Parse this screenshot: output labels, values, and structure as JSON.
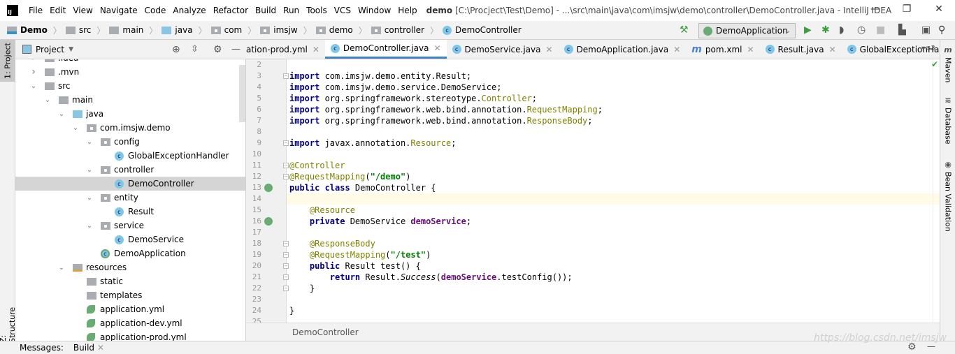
{
  "titlebar": {
    "menu": [
      "File",
      "Edit",
      "View",
      "Navigate",
      "Code",
      "Analyze",
      "Refactor",
      "Build",
      "Run",
      "Tools",
      "VCS",
      "Window",
      "Help"
    ],
    "project": "demo",
    "path": "[C:\\Procject\\Test\\Demo] - ...\\src\\main\\java\\com\\imsjw\\demo\\controller\\DemoController.java - IntelliJ IDEA",
    "logo": "IJ"
  },
  "navbar": {
    "crumbs": [
      {
        "label": "Demo",
        "icon": "module"
      },
      {
        "label": "src",
        "icon": "folder"
      },
      {
        "label": "main",
        "icon": "folder"
      },
      {
        "label": "java",
        "icon": "source-folder"
      },
      {
        "label": "com",
        "icon": "package"
      },
      {
        "label": "imsjw",
        "icon": "package"
      },
      {
        "label": "demo",
        "icon": "package"
      },
      {
        "label": "controller",
        "icon": "package"
      },
      {
        "label": "DemoController",
        "icon": "class"
      }
    ],
    "run_config": "DemoApplication"
  },
  "left_strip": {
    "project_tab": "1: Project",
    "structure_tab": "Z: Structure"
  },
  "project_panel": {
    "title": "Project",
    "tree": [
      {
        "label": ".idea",
        "level": 1,
        "type": "folder",
        "arrow": "right"
      },
      {
        "label": ".mvn",
        "level": 1,
        "type": "folder",
        "arrow": "right"
      },
      {
        "label": "src",
        "level": 1,
        "type": "folder",
        "arrow": "down"
      },
      {
        "label": "main",
        "level": 2,
        "type": "folder",
        "arrow": "down"
      },
      {
        "label": "java",
        "level": 3,
        "type": "source",
        "arrow": "down"
      },
      {
        "label": "com.imsjw.demo",
        "level": 4,
        "type": "package",
        "arrow": "down"
      },
      {
        "label": "config",
        "level": 5,
        "type": "package",
        "arrow": "down"
      },
      {
        "label": "GlobalExceptionHandler",
        "level": 6,
        "type": "class"
      },
      {
        "label": "controller",
        "level": 5,
        "type": "package",
        "arrow": "down"
      },
      {
        "label": "DemoController",
        "level": 6,
        "type": "class",
        "selected": true
      },
      {
        "label": "entity",
        "level": 5,
        "type": "package",
        "arrow": "down"
      },
      {
        "label": "Result",
        "level": 6,
        "type": "class"
      },
      {
        "label": "service",
        "level": 5,
        "type": "package",
        "arrow": "down"
      },
      {
        "label": "DemoService",
        "level": 6,
        "type": "class"
      },
      {
        "label": "DemoApplication",
        "level": 5,
        "type": "spring-class"
      },
      {
        "label": "resources",
        "level": 3,
        "type": "resources",
        "arrow": "down"
      },
      {
        "label": "static",
        "level": 4,
        "type": "folder"
      },
      {
        "label": "templates",
        "level": 4,
        "type": "folder"
      },
      {
        "label": "application.yml",
        "level": 4,
        "type": "yml"
      },
      {
        "label": "application-dev.yml",
        "level": 4,
        "type": "yml"
      },
      {
        "label": "application-prod.yml",
        "level": 4,
        "type": "yml"
      }
    ]
  },
  "tabs": [
    {
      "label": "ation-prod.yml",
      "icon": "none"
    },
    {
      "label": "DemoController.java",
      "icon": "class",
      "active": true
    },
    {
      "label": "DemoService.java",
      "icon": "class"
    },
    {
      "label": "DemoApplication.java",
      "icon": "spring-class"
    },
    {
      "label": "pom.xml",
      "icon": "maven"
    },
    {
      "label": "Result.java",
      "icon": "class"
    },
    {
      "label": "GlobalExceptionHandler.java",
      "icon": "class"
    }
  ],
  "tabs_overflow": "3",
  "editor": {
    "current_line": 14,
    "lines": [
      {
        "n": 2,
        "t": []
      },
      {
        "n": 3,
        "fold": true,
        "t": [
          [
            "import",
            "kw"
          ],
          [
            " com.imsjw.demo.entity.Result;",
            ""
          ]
        ]
      },
      {
        "n": 4,
        "t": [
          [
            "import",
            "kw"
          ],
          [
            " com.imsjw.demo.service.DemoService;",
            ""
          ]
        ]
      },
      {
        "n": 5,
        "t": [
          [
            "import",
            "kw"
          ],
          [
            " org.springframework.stereotype.",
            ""
          ],
          [
            "Controller",
            "an"
          ],
          [
            ";",
            ""
          ]
        ]
      },
      {
        "n": 6,
        "t": [
          [
            "import",
            "kw"
          ],
          [
            " org.springframework.web.bind.annotation.",
            ""
          ],
          [
            "RequestMapping",
            "an"
          ],
          [
            ";",
            ""
          ]
        ]
      },
      {
        "n": 7,
        "t": [
          [
            "import",
            "kw"
          ],
          [
            " org.springframework.web.bind.annotation.",
            ""
          ],
          [
            "ResponseBody",
            "an"
          ],
          [
            ";",
            ""
          ]
        ]
      },
      {
        "n": 8,
        "t": []
      },
      {
        "n": 9,
        "fold": true,
        "t": [
          [
            "import",
            "kw"
          ],
          [
            " javax.annotation.",
            ""
          ],
          [
            "Resource",
            "an"
          ],
          [
            ";",
            ""
          ]
        ]
      },
      {
        "n": 10,
        "t": []
      },
      {
        "n": 11,
        "fold": true,
        "t": [
          [
            "@Controller",
            "an"
          ]
        ]
      },
      {
        "n": 12,
        "fold": true,
        "t": [
          [
            "@RequestMapping",
            "an"
          ],
          [
            "(",
            ""
          ],
          [
            "\"/demo\"",
            "st"
          ],
          [
            ")",
            ""
          ]
        ]
      },
      {
        "n": 13,
        "gicon": true,
        "t": [
          [
            "public class",
            "kw"
          ],
          [
            " DemoController {",
            ""
          ]
        ]
      },
      {
        "n": 14,
        "t": []
      },
      {
        "n": 15,
        "t": [
          [
            "    ",
            ""
          ],
          [
            "@Resource",
            "an"
          ]
        ]
      },
      {
        "n": 16,
        "gicon": true,
        "t": [
          [
            "    ",
            ""
          ],
          [
            "private",
            "kw"
          ],
          [
            " DemoService ",
            ""
          ],
          [
            "demoService",
            "fd"
          ],
          [
            ";",
            ""
          ]
        ]
      },
      {
        "n": 17,
        "t": []
      },
      {
        "n": 18,
        "fold": true,
        "t": [
          [
            "    ",
            ""
          ],
          [
            "@ResponseBody",
            "an"
          ]
        ]
      },
      {
        "n": 19,
        "fold": true,
        "t": [
          [
            "    ",
            ""
          ],
          [
            "@RequestMapping",
            "an"
          ],
          [
            "(",
            ""
          ],
          [
            "\"/test\"",
            "st"
          ],
          [
            ")",
            ""
          ]
        ]
      },
      {
        "n": 20,
        "fold": true,
        "t": [
          [
            "    ",
            ""
          ],
          [
            "public",
            "kw"
          ],
          [
            " Result test() {",
            ""
          ]
        ]
      },
      {
        "n": 21,
        "fold": true,
        "t": [
          [
            "        ",
            ""
          ],
          [
            "return",
            "kw"
          ],
          [
            " Result.",
            ""
          ],
          [
            "Success",
            "it"
          ],
          [
            "(",
            ""
          ],
          [
            "demoService",
            "fd"
          ],
          [
            ".testConfig());",
            ""
          ]
        ]
      },
      {
        "n": 22,
        "fold": true,
        "t": [
          [
            "    }",
            ""
          ]
        ]
      },
      {
        "n": 23,
        "t": []
      },
      {
        "n": 24,
        "t": [
          [
            "}",
            ""
          ]
        ]
      },
      {
        "n": 25,
        "t": []
      }
    ]
  },
  "editor_breadcrumb": "DemoController",
  "right_strip": [
    "Maven",
    "Database",
    "Bean Validation"
  ],
  "bottom": {
    "messages": "Messages:",
    "build": "Build"
  },
  "watermark": "https://blog.csdn.net/imsjw",
  "colors": {
    "accent": "#4083c9",
    "class_icon": "#7ec7e6",
    "run_green": "#3c9f3c"
  }
}
